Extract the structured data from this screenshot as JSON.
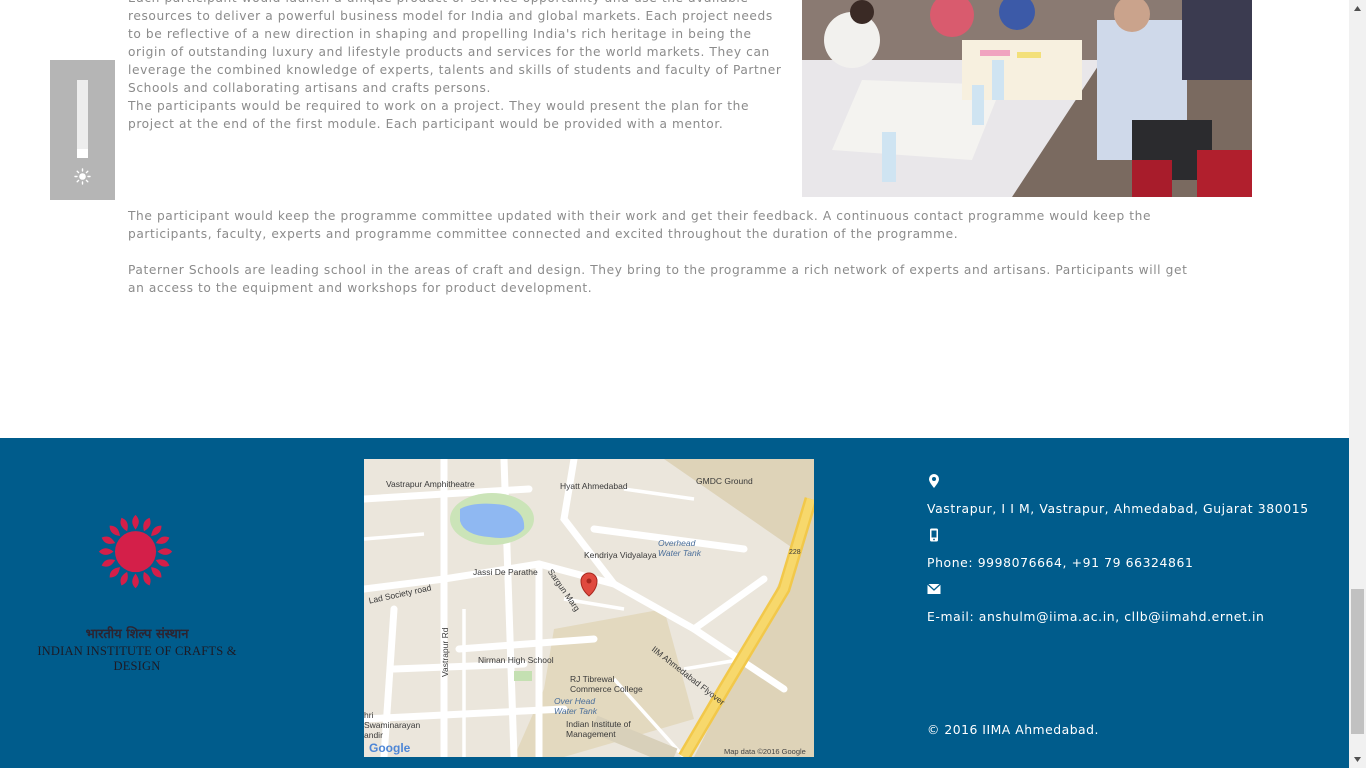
{
  "content": {
    "paragraphs": [
      "Each participant would launch a unique product or service opportunity and use the available resources to deliver a powerful business model for India and global markets. Each project needs to be reflective of a new direction in shaping and propelling India's rich heritage in being the origin of outstanding luxury and lifestyle products and services for the world markets. They can leverage the combined knowledge of experts, talents and skills of students and faculty of Partner Schools and collaborating artisans and crafts persons.",
      "The participants would be required to work on a project. They would present the plan for the project at the end of the first module. Each participant would be provided with a mentor.",
      "The participant would keep the programme committee updated with their work and get their feedback. A continuous contact programme would keep the participants, faculty, experts and programme committee connected and excited throughout the duration of the programme.",
      "Paterner Schools are leading school in the areas of craft and design. They bring to the programme a rich network of experts and artisans. Participants will get an access to the equipment and workshops for product development."
    ]
  },
  "accessibility": {
    "slider_level": 0.12,
    "icon": "brightness-icon"
  },
  "footer": {
    "logo": {
      "hindi": "भारतीय शिल्प संस्थान",
      "english": "INDIAN INSTITUTE OF CRAFTS & DESIGN",
      "color": "#d41f49"
    },
    "map": {
      "labels": {
        "vastrapur_amphitheatre": "Vastrapur Amphitheatre",
        "hyatt": "Hyatt Ahmedabad",
        "gmdc": "GMDC Ground",
        "kendriya": "Kendriya Vidyalaya",
        "overhead_tank_1": "Overhead Water Tank",
        "jassi": "Jassi De Parathe",
        "sargun": "Sargun Marg",
        "lad_society": "Lad Society road",
        "vastrapur_rd": "Vastrapur Rd",
        "nirman": "Nirman High School",
        "rj_tibrewal": "RJ Tibrewal Commerce College",
        "overhead_tank_2": "Over Head Water Tank",
        "iima_flyover": "IIM Ahmedabad Flyover",
        "iim": "Indian Institute of Management",
        "swaminarayan": "hri Swaminarayan andir",
        "road_228": "228",
        "google": "Google",
        "map_data": "Map data ©2016 Google"
      }
    },
    "contact": {
      "address": "Vastrapur, I I M, Vastrapur, Ahmedabad, Gujarat 380015",
      "phone": "Phone: 9998076664, +91 79 66324861",
      "email": "E-mail: anshulm@iima.ac.in, cllb@iimahd.ernet.in",
      "icons": [
        "location-pin-icon",
        "mobile-phone-icon",
        "envelope-icon"
      ]
    },
    "copyright": "© 2016 IIMA Ahmedabad.",
    "colors": {
      "background": "#005c8c",
      "text": "#ffffff"
    }
  }
}
